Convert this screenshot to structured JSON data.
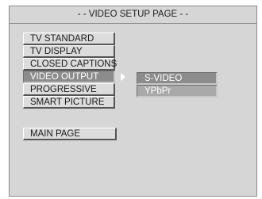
{
  "header": {
    "title": "- - VIDEO SETUP PAGE - -"
  },
  "menu": {
    "items": [
      {
        "label": "TV STANDARD"
      },
      {
        "label": "TV DISPLAY"
      },
      {
        "label": "CLOSED CAPTIONS"
      },
      {
        "label": "VIDEO OUTPUT",
        "selected": true
      },
      {
        "label": "PROGRESSIVE"
      },
      {
        "label": "SMART PICTURE"
      }
    ],
    "main_page_label": "MAIN PAGE"
  },
  "submenu": {
    "options": [
      {
        "label": "S-VIDEO"
      },
      {
        "label": "YPbPr"
      }
    ]
  },
  "colors": {
    "background": "#d6d6d6",
    "selected": "#8c8c8c",
    "text": "#1a1a1a"
  }
}
